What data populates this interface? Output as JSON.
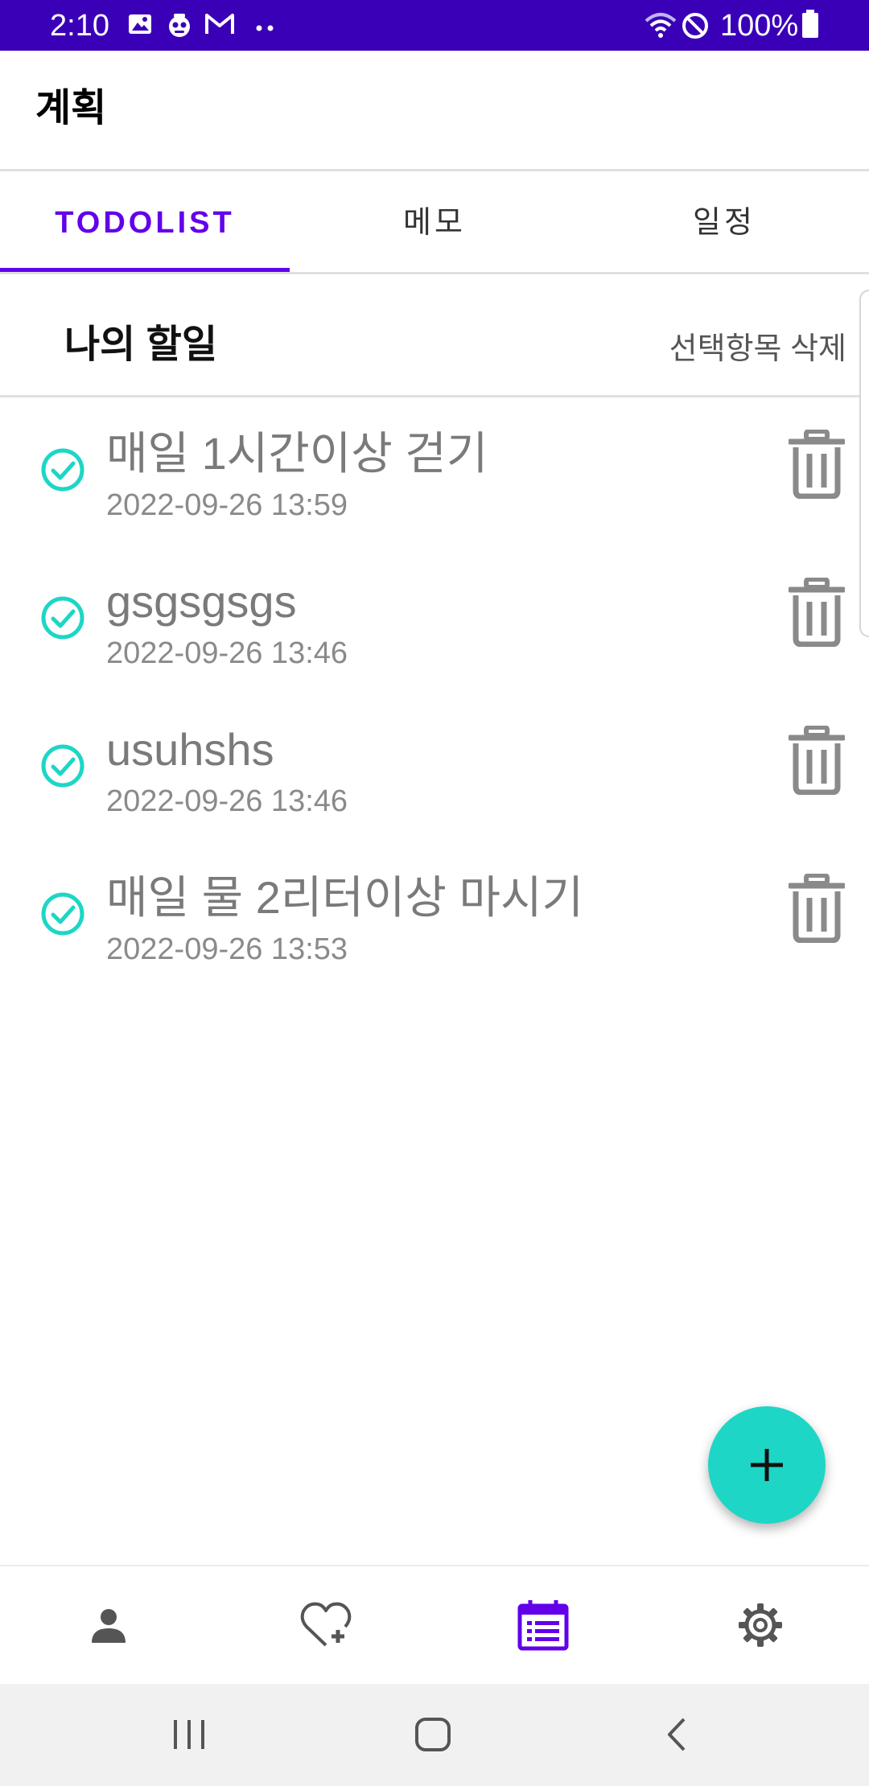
{
  "status_bar": {
    "time": "2:10",
    "battery": "100%",
    "icons": [
      "gallery-icon",
      "app-face-icon",
      "gmail-icon",
      "more-dots-icon",
      "wifi-icon",
      "do-not-disturb-icon",
      "battery-icon"
    ]
  },
  "app_bar": {
    "title": "계획"
  },
  "tabs": [
    {
      "label": "TODOLIST",
      "active": true
    },
    {
      "label": "메모",
      "active": false
    },
    {
      "label": "일정",
      "active": false
    }
  ],
  "section": {
    "heading": "나의 할일",
    "delete_selected": "선택항목 삭제"
  },
  "todos": [
    {
      "title": "매일 1시간이상 걷기",
      "date": "2022-09-26 13:59",
      "checked": true
    },
    {
      "title": "gsgsgsgs",
      "date": "2022-09-26 13:46",
      "checked": true
    },
    {
      "title": "usuhshs",
      "date": "2022-09-26 13:46",
      "checked": true
    },
    {
      "title": "매일 물 2리터이상 마시기",
      "date": "2022-09-26 13:53",
      "checked": true
    }
  ],
  "fab": {
    "icon": "plus-icon"
  },
  "bottom_nav": [
    {
      "icon": "person-icon",
      "active": false
    },
    {
      "icon": "heart-plus-icon",
      "active": false
    },
    {
      "icon": "calendar-list-icon",
      "active": true
    },
    {
      "icon": "gear-icon",
      "active": false
    }
  ],
  "colors": {
    "status_bar": "#3a00b8",
    "accent": "#6200ea",
    "check": "#1dd6c6",
    "fab": "#1dd6c6",
    "muted_text": "#7a7a7a"
  }
}
